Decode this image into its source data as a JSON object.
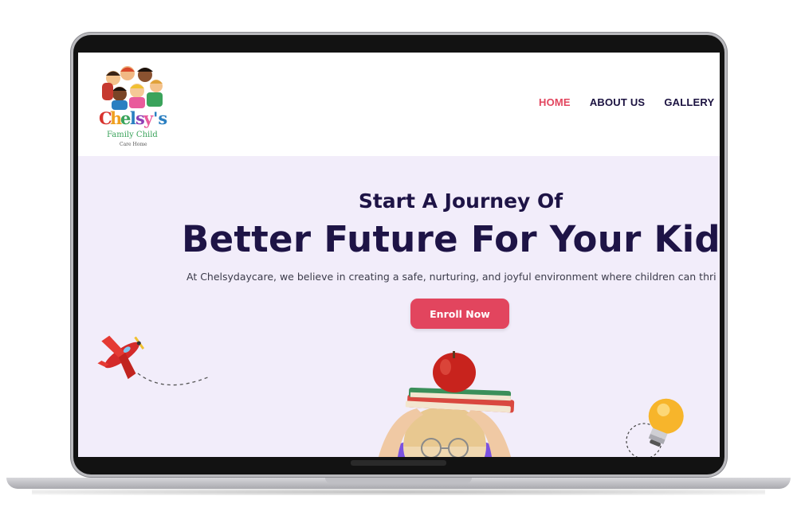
{
  "brand": {
    "logo_text": "Chelsy's",
    "logo_subtext": "Family Child",
    "logo_caption": "Care Home"
  },
  "nav": {
    "items": [
      {
        "label": "HOME",
        "active": true
      },
      {
        "label": "ABOUT US",
        "active": false
      },
      {
        "label": "GALLERY",
        "active": false
      }
    ]
  },
  "hero": {
    "subtitle": "Start A Journey Of",
    "title": "Better Future For Your Kid",
    "description": "At Chelsydaycare, we believe in creating a safe, nurturing, and joyful environment where children can thri",
    "cta_label": "Enroll Now"
  },
  "colors": {
    "accent": "#e2455e",
    "heading": "#1e1446",
    "hero_bg": "#f2edfa"
  },
  "decor": {
    "airplane": "toy-airplane-icon",
    "bulb": "light-bulb-icon",
    "kid": "child-with-books-and-apple"
  }
}
